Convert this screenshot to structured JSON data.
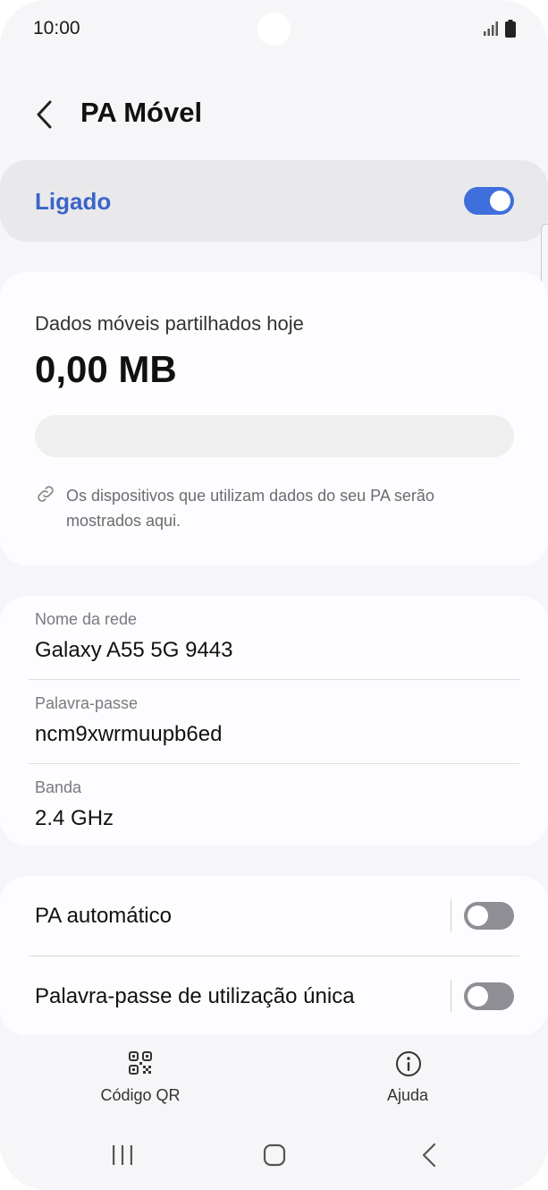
{
  "status_bar": {
    "time": "10:00"
  },
  "header": {
    "title": "PA Móvel"
  },
  "master_switch": {
    "label": "Ligado",
    "on": true
  },
  "usage": {
    "label": "Dados móveis partilhados hoje",
    "value": "0,00 MB",
    "fraction": 0,
    "note": "Os dispositivos que utilizam dados do seu PA serão mostrados aqui."
  },
  "network": {
    "fields": [
      {
        "label": "Nome da rede",
        "value": "Galaxy A55 5G 9443"
      },
      {
        "label": "Palavra-passe",
        "value": "ncm9xwrmuupb6ed"
      },
      {
        "label": "Banda",
        "value": "2.4 GHz"
      }
    ]
  },
  "options": [
    {
      "label": "PA automático",
      "on": false
    },
    {
      "label": "Palavra-passe de utilização única",
      "on": false
    }
  ],
  "bottom_actions": {
    "qr_label": "Código QR",
    "help_label": "Ajuda"
  },
  "colors": {
    "accent": "#3e6fdc",
    "accent_text": "#3b64c8",
    "switch_off": "#8e8e94"
  },
  "icons": [
    "signal-icon",
    "battery-icon",
    "back-arrow-icon",
    "link-icon",
    "qr-code-icon",
    "info-icon",
    "recents-icon",
    "home-icon",
    "nav-back-icon"
  ]
}
